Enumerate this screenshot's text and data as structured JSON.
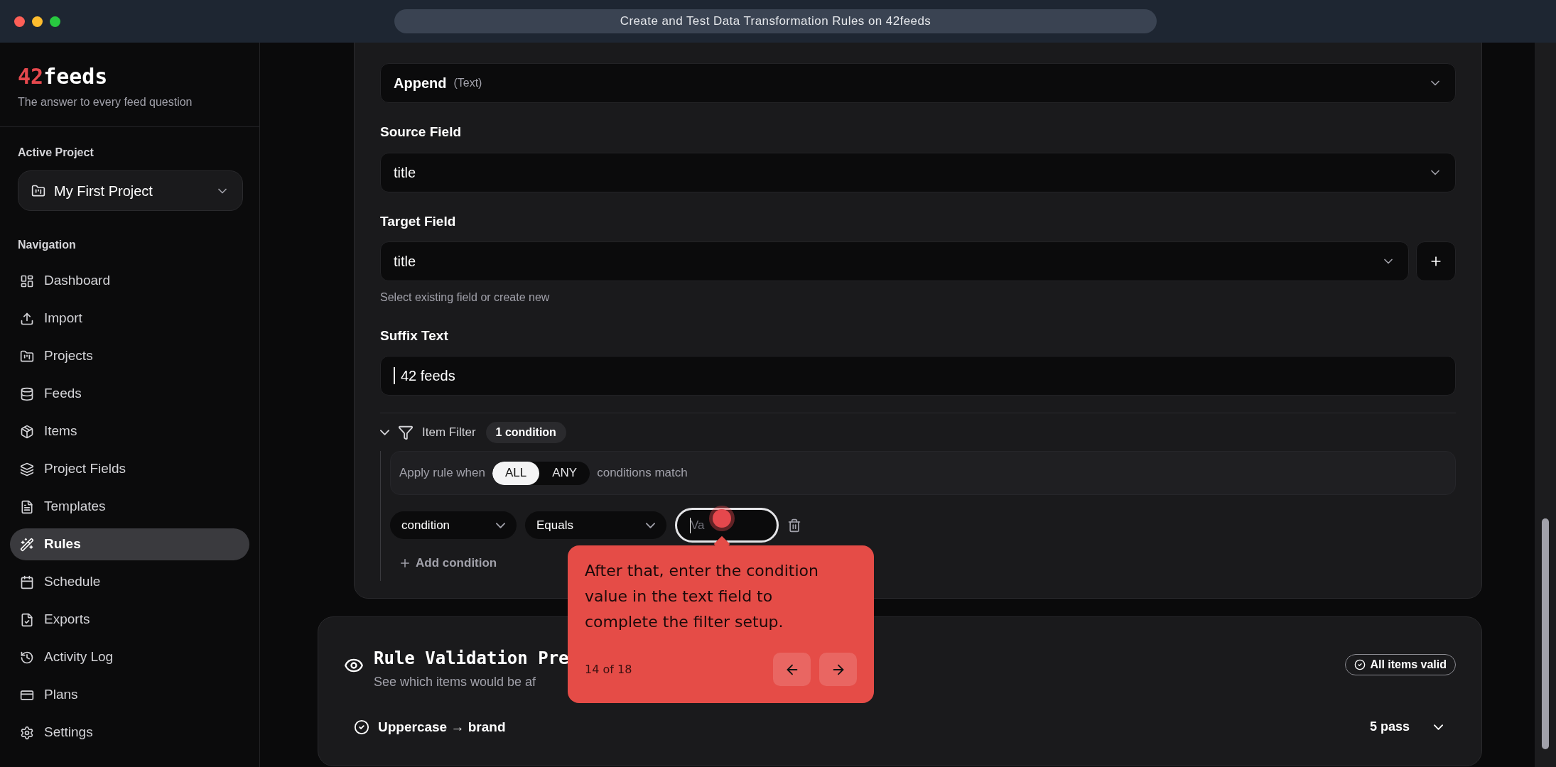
{
  "window": {
    "title": "Create and Test Data Transformation Rules on 42feeds"
  },
  "brand": {
    "accent": "42",
    "name": "feeds",
    "tagline": "The answer to every feed question"
  },
  "active_project": {
    "label": "Active Project",
    "value": "My First Project"
  },
  "navigation": {
    "label": "Navigation",
    "items": [
      {
        "label": "Dashboard",
        "selected": false
      },
      {
        "label": "Import",
        "selected": false
      },
      {
        "label": "Projects",
        "selected": false
      },
      {
        "label": "Feeds",
        "selected": false
      },
      {
        "label": "Items",
        "selected": false
      },
      {
        "label": "Project Fields",
        "selected": false
      },
      {
        "label": "Templates",
        "selected": false
      },
      {
        "label": "Rules",
        "selected": true
      },
      {
        "label": "Schedule",
        "selected": false
      },
      {
        "label": "Exports",
        "selected": false
      },
      {
        "label": "Activity Log",
        "selected": false
      },
      {
        "label": "Plans",
        "selected": false
      },
      {
        "label": "Settings",
        "selected": false
      }
    ]
  },
  "form": {
    "transformation_type": {
      "value": "Append",
      "hint": "(Text)"
    },
    "source_field": {
      "label": "Source Field",
      "value": "title"
    },
    "target_field": {
      "label": "Target Field",
      "value": "title",
      "help": "Select existing field or create new"
    },
    "suffix_text": {
      "label": "Suffix Text",
      "value": "42 feeds"
    }
  },
  "item_filter": {
    "label": "Item Filter",
    "expanded": true,
    "count": "1 condition",
    "apply_prefix": "Apply rule when",
    "modes": [
      {
        "label": "ALL",
        "selected": true
      },
      {
        "label": "ANY",
        "selected": false
      }
    ],
    "apply_suffix": "conditions match",
    "conditions": [
      {
        "field": "condition",
        "operator": "Equals",
        "placeholder": "Va"
      }
    ],
    "add_label": "Add condition"
  },
  "validation": {
    "title": "Rule Validation Pre",
    "subtitle": "See which items would be af",
    "status": "All items valid",
    "rules": [
      {
        "name": "Uppercase → brand",
        "result": "5 pass",
        "expanded": false
      }
    ]
  },
  "tour": {
    "text": "After that, enter the condition value in the text field to complete the filter setup.",
    "step": "14 of 18"
  }
}
